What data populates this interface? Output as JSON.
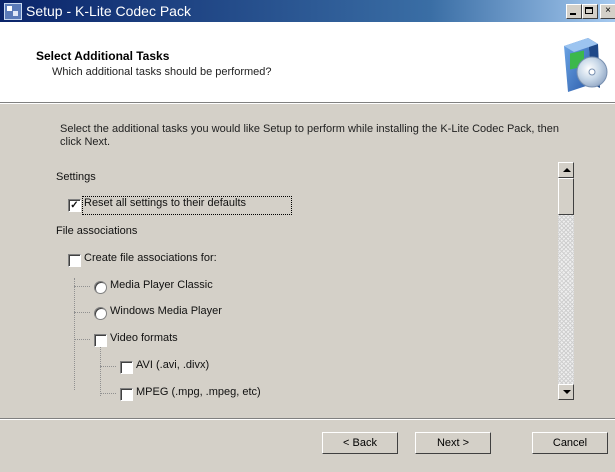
{
  "window": {
    "title": "Setup - K-Lite Codec Pack",
    "minimize": "",
    "maximize": "",
    "close": "×"
  },
  "header": {
    "title": "Select Additional Tasks",
    "subtitle": "Which additional tasks should be performed?"
  },
  "intro": "Select the additional tasks you would like Setup to perform while installing the K-Lite Codec Pack, then click Next.",
  "tasks": [
    {
      "type": "heading",
      "label": "Settings"
    },
    {
      "type": "checkbox",
      "label": "Reset all settings to their defaults",
      "checked": true
    },
    {
      "type": "heading",
      "label": "File associations"
    },
    {
      "type": "checkbox",
      "label": "Create file associations for:",
      "checked": false
    },
    {
      "type": "radio",
      "label": "Media Player Classic",
      "checked": false
    },
    {
      "type": "radio",
      "label": "Windows Media Player",
      "checked": false
    },
    {
      "type": "checkbox",
      "label": "Video formats",
      "checked": false
    },
    {
      "type": "checkbox",
      "label": "AVI (.avi, .divx)",
      "checked": false
    },
    {
      "type": "checkbox",
      "label": "MPEG (.mpg, .mpeg, etc)",
      "checked": false
    }
  ],
  "check_glyph": "✓",
  "buttons": {
    "back": "< Back",
    "next": "Next >",
    "cancel": "Cancel"
  },
  "icons": {
    "app": "setup-app-icon",
    "logo": "software-box-cd-icon"
  }
}
